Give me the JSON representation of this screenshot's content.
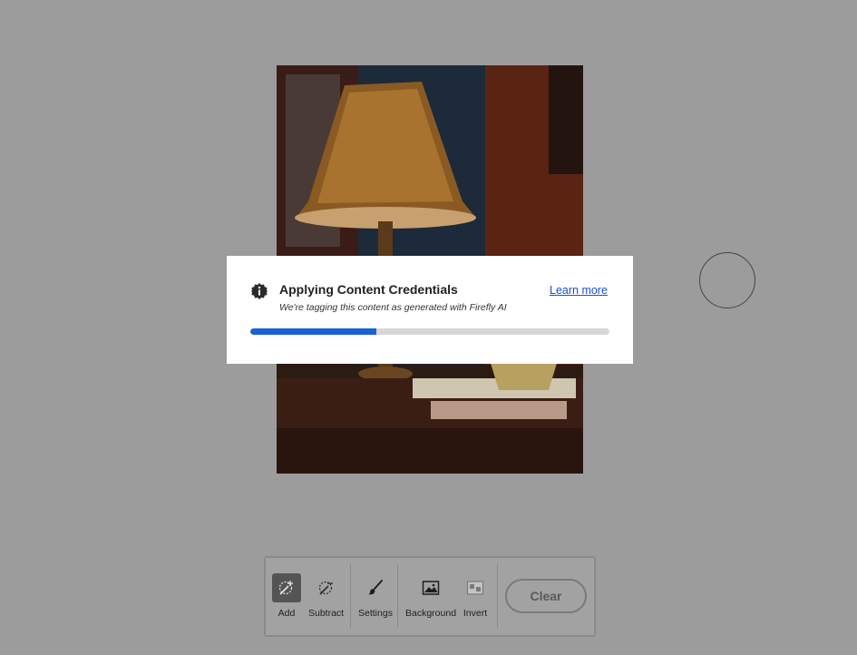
{
  "toast": {
    "title": "Applying Content Credentials",
    "subtitle": "We're tagging this content as generated with Firefly AI",
    "learn_more": "Learn more",
    "progress": 0.35
  },
  "toolbar": {
    "tools": [
      {
        "label": "Add",
        "icon": "brush-add-icon",
        "active": true
      },
      {
        "label": "Subtract",
        "icon": "brush-subtract-icon",
        "active": false
      },
      {
        "label": "Settings",
        "icon": "paintbrush-icon",
        "active": false
      },
      {
        "label": "Background",
        "icon": "image-icon",
        "active": false
      },
      {
        "label": "Invert",
        "icon": "invert-icon",
        "active": false
      }
    ],
    "clear_label": "Clear"
  },
  "colors": {
    "backdrop": "#9c9c9c",
    "progress_fill": "#1a60d8",
    "link": "#1a4fd6",
    "active_tool": "#545454"
  }
}
